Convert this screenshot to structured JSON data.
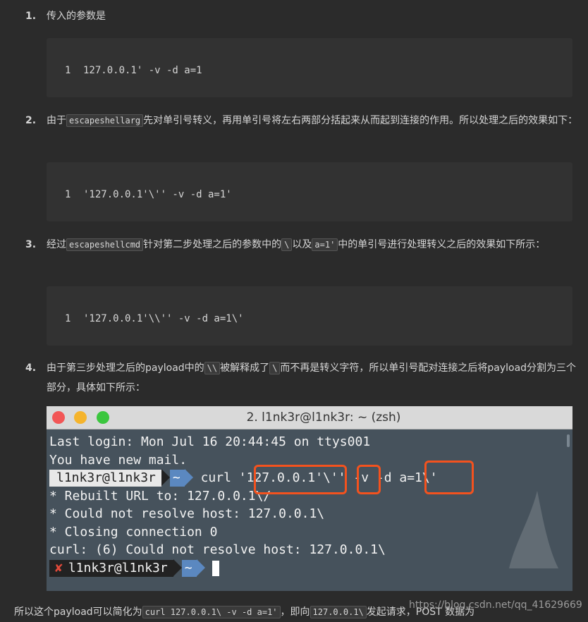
{
  "steps": [
    {
      "num": "1.",
      "text": "传入的参数是"
    },
    {
      "num": "2.",
      "pre": "由于",
      "code1": "escapeshellarg",
      "post": "先对单引号转义，再用单引号将左右两部分括起来从而起到连接的作用。所以处理之后的效果如下："
    },
    {
      "num": "3.",
      "pre": "经过",
      "code1": "escapeshellcmd",
      "mid1": "针对第二步处理之后的参数中的",
      "code2": "\\",
      "mid2": "以及",
      "code3": "a=1'",
      "post": "中的单引号进行处理转义之后的效果如下所示："
    },
    {
      "num": "4.",
      "pre": "由于第三步处理之后的payload中的",
      "code1": "\\\\",
      "mid1": "被解释成了",
      "code2": "\\",
      "post": "而不再是转义字符，所以单引号配对连接之后将payload分割为三个部分，具体如下所示："
    }
  ],
  "codeblocks": [
    {
      "line": "1",
      "code": "127.0.0.1' -v -d a=1"
    },
    {
      "line": "1",
      "code": "'127.0.0.1'\\'' -v -d a=1'"
    },
    {
      "line": "1",
      "code": "'127.0.0.1'\\\\'' -v -d a=1\\'"
    }
  ],
  "terminal": {
    "title": "2. l1nk3r@l1nk3r: ~ (zsh)",
    "last_login": "Last login: Mon Jul 16 20:44:45 on ttys001",
    "mail": "You have new mail.",
    "prompt_user": "l1nk3r@l1nk3r",
    "prompt_dir": "~",
    "cmd_curl": "curl ",
    "cmd_arg1": "'127.0.0.1'",
    "cmd_bs": "\\",
    "cmd_arg2": "''",
    "cmd_flags": " -v -d ",
    "cmd_arg3": "a=1\\'",
    "out1": "* Rebuilt URL to: 127.0.0.1\\/",
    "out2": "* Could not resolve host: 127.0.0.1\\",
    "out3": "* Closing connection 0",
    "out4": "curl: (6) Could not resolve host: 127.0.0.1\\",
    "err_mark": "✘"
  },
  "bottom": {
    "pre": "所以这个payload可以简化为",
    "code1": "curl 127.0.0.1\\ -v -d a=1'",
    "mid": "，即向",
    "code2": "127.0.0.1\\",
    "post": "发起请求，POST 数据为"
  },
  "watermark": "https://blog.csdn.net/qq_41629669",
  "colors": {
    "highlight": "#f4521e",
    "terminal_bg": "#46525c",
    "page_bg": "#2b2b2b"
  }
}
